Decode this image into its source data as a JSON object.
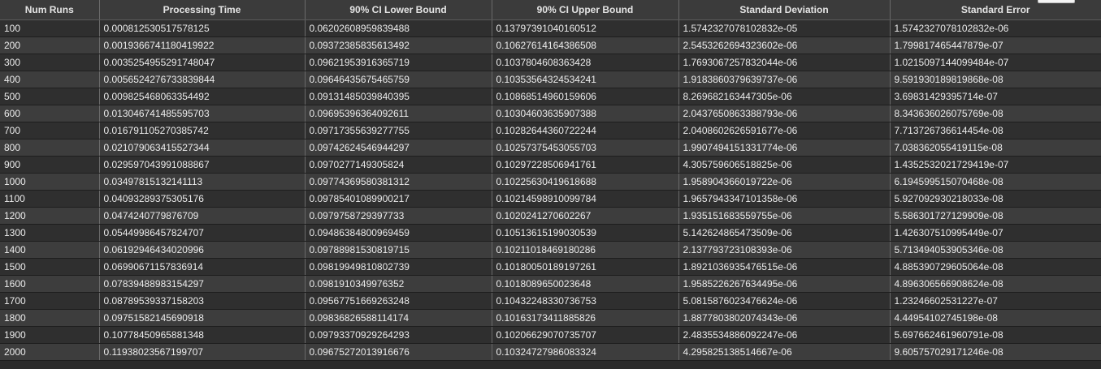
{
  "table": {
    "columns": [
      "Num Runs",
      "Processing Time",
      "90% CI Lower Bound",
      "90% CI Upper Bound",
      "Standard Deviation",
      "Standard Error"
    ],
    "rows": [
      [
        "100",
        "0.000812530517578125",
        "0.06202608959839488",
        "0.13797391040160512",
        "1.5742327078102832e-05",
        "1.5742327078102832e-06"
      ],
      [
        "200",
        "0.0019366741180419922",
        "0.09372385835613492",
        "0.10627614164386508",
        "2.5453262694323602e-06",
        "1.799817465447879e-07"
      ],
      [
        "300",
        "0.0035254955291748047",
        "0.09621953916365719",
        "0.1037804608363428",
        "1.7693067257832044e-06",
        "1.0215097144099484e-07"
      ],
      [
        "400",
        "0.0056524276733839844",
        "0.09646435675465759",
        "0.10353564324534241",
        "1.9183860379639737e-06",
        "9.591930189819868e-08"
      ],
      [
        "500",
        "0.009825468063354492",
        "0.09131485039840395",
        "0.10868514960159606",
        "8.269682163447305e-06",
        "3.69831429395714e-07"
      ],
      [
        "600",
        "0.013046741485595703",
        "0.09695396364092611",
        "0.10304603635907388",
        "2.0437650863388793e-06",
        "8.343636026075769e-08"
      ],
      [
        "700",
        "0.016791105270385742",
        "0.09717355639277755",
        "0.10282644360722244",
        "2.0408602626591677e-06",
        "7.713726736614454e-08"
      ],
      [
        "800",
        "0.021079063415527344",
        "0.09742624546944297",
        "0.10257375453055703",
        "1.9907494151331774e-06",
        "7.038362055419115e-08"
      ],
      [
        "900",
        "0.029597043991088867",
        "0.0970277149305824",
        "0.10297228506941761",
        "4.305759606518825e-06",
        "1.4352532021729419e-07"
      ],
      [
        "1000",
        "0.03497815132141113",
        "0.09774369580381312",
        "0.10225630419618688",
        "1.958904366019722e-06",
        "6.194599515070468e-08"
      ],
      [
        "1100",
        "0.04093289375305176",
        "0.09785401089900217",
        "0.10214598910099784",
        "1.9657943347101358e-06",
        "5.927092930218033e-08"
      ],
      [
        "1200",
        "0.0474240779876709",
        "0.0979758729397733",
        "0.1020241270602267",
        "1.935151683559755e-06",
        "5.586301727129909e-08"
      ],
      [
        "1300",
        "0.05449986457824707",
        "0.09486384800969459",
        "0.10513615199030539",
        "5.142624865473509e-06",
        "1.426307510995449e-07"
      ],
      [
        "1400",
        "0.06192946434020996",
        "0.09788981530819715",
        "0.10211018469180286",
        "2.137793723108393e-06",
        "5.713494053905346e-08"
      ],
      [
        "1500",
        "0.06990671157836914",
        "0.09819949810802739",
        "0.10180050189197261",
        "1.8921036935476515e-06",
        "4.885390729605064e-08"
      ],
      [
        "1600",
        "0.07839488983154297",
        "0.0981910349976352",
        "0.1018089650023648",
        "1.9585226267634495e-06",
        "4.896306566908624e-08"
      ],
      [
        "1700",
        "0.08789539337158203",
        "0.09567751669263248",
        "0.10432248330736753",
        "5.0815876023476624e-06",
        "1.23246602531227e-07"
      ],
      [
        "1800",
        "0.09751582145690918",
        "0.09836826588114174",
        "0.10163173411885826",
        "1.8877803802074343e-06",
        "4.44954102745198e-08"
      ],
      [
        "1900",
        "0.10778450965881348",
        "0.09793370929264293",
        "0.10206629070735707",
        "2.4835534886092247e-06",
        "5.697662461960791e-08"
      ],
      [
        "2000",
        "0.11938023567199707",
        "0.09675272013916676",
        "0.10324727986083324",
        "4.295825138514667e-06",
        "9.605757029171246e-08"
      ]
    ]
  }
}
